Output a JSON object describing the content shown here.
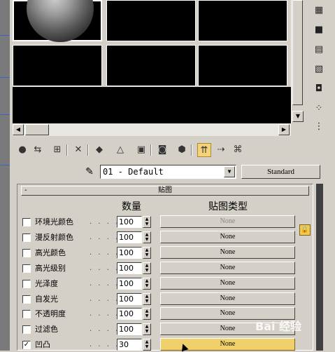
{
  "slot_grid": {
    "rows": 2,
    "cols": 3,
    "active_slot": 0
  },
  "map_type_button": "Standard",
  "material": {
    "name": "01 - Default"
  },
  "rollout": {
    "collapse_symbol": "-",
    "title": "贴图"
  },
  "columns": {
    "amount": "数量",
    "map_type": "贴图类型"
  },
  "maps": [
    {
      "label": "环境光颜色",
      "checked": false,
      "amount": "100",
      "map": "None",
      "state": "dim"
    },
    {
      "label": "漫反射颜色",
      "checked": false,
      "amount": "100",
      "map": "None",
      "state": "normal"
    },
    {
      "label": "高光颜色",
      "checked": false,
      "amount": "100",
      "map": "None",
      "state": "normal"
    },
    {
      "label": "高光级别",
      "checked": false,
      "amount": "100",
      "map": "None",
      "state": "normal"
    },
    {
      "label": "光泽度",
      "checked": false,
      "amount": "100",
      "map": "None",
      "state": "normal"
    },
    {
      "label": "自发光",
      "checked": false,
      "amount": "100",
      "map": "None",
      "state": "normal"
    },
    {
      "label": "不透明度",
      "checked": false,
      "amount": "100",
      "map": "None",
      "state": "normal"
    },
    {
      "label": "过滤色",
      "checked": false,
      "amount": "100",
      "map": "None",
      "state": "normal"
    },
    {
      "label": "凹凸",
      "checked": true,
      "amount": "30",
      "map": "None",
      "state": "active"
    }
  ],
  "watermark": "Bai 经验",
  "colors": {
    "panel_bg": "#d4d0c8",
    "active_map": "#f0d06a",
    "lock": "#f2c94c"
  }
}
